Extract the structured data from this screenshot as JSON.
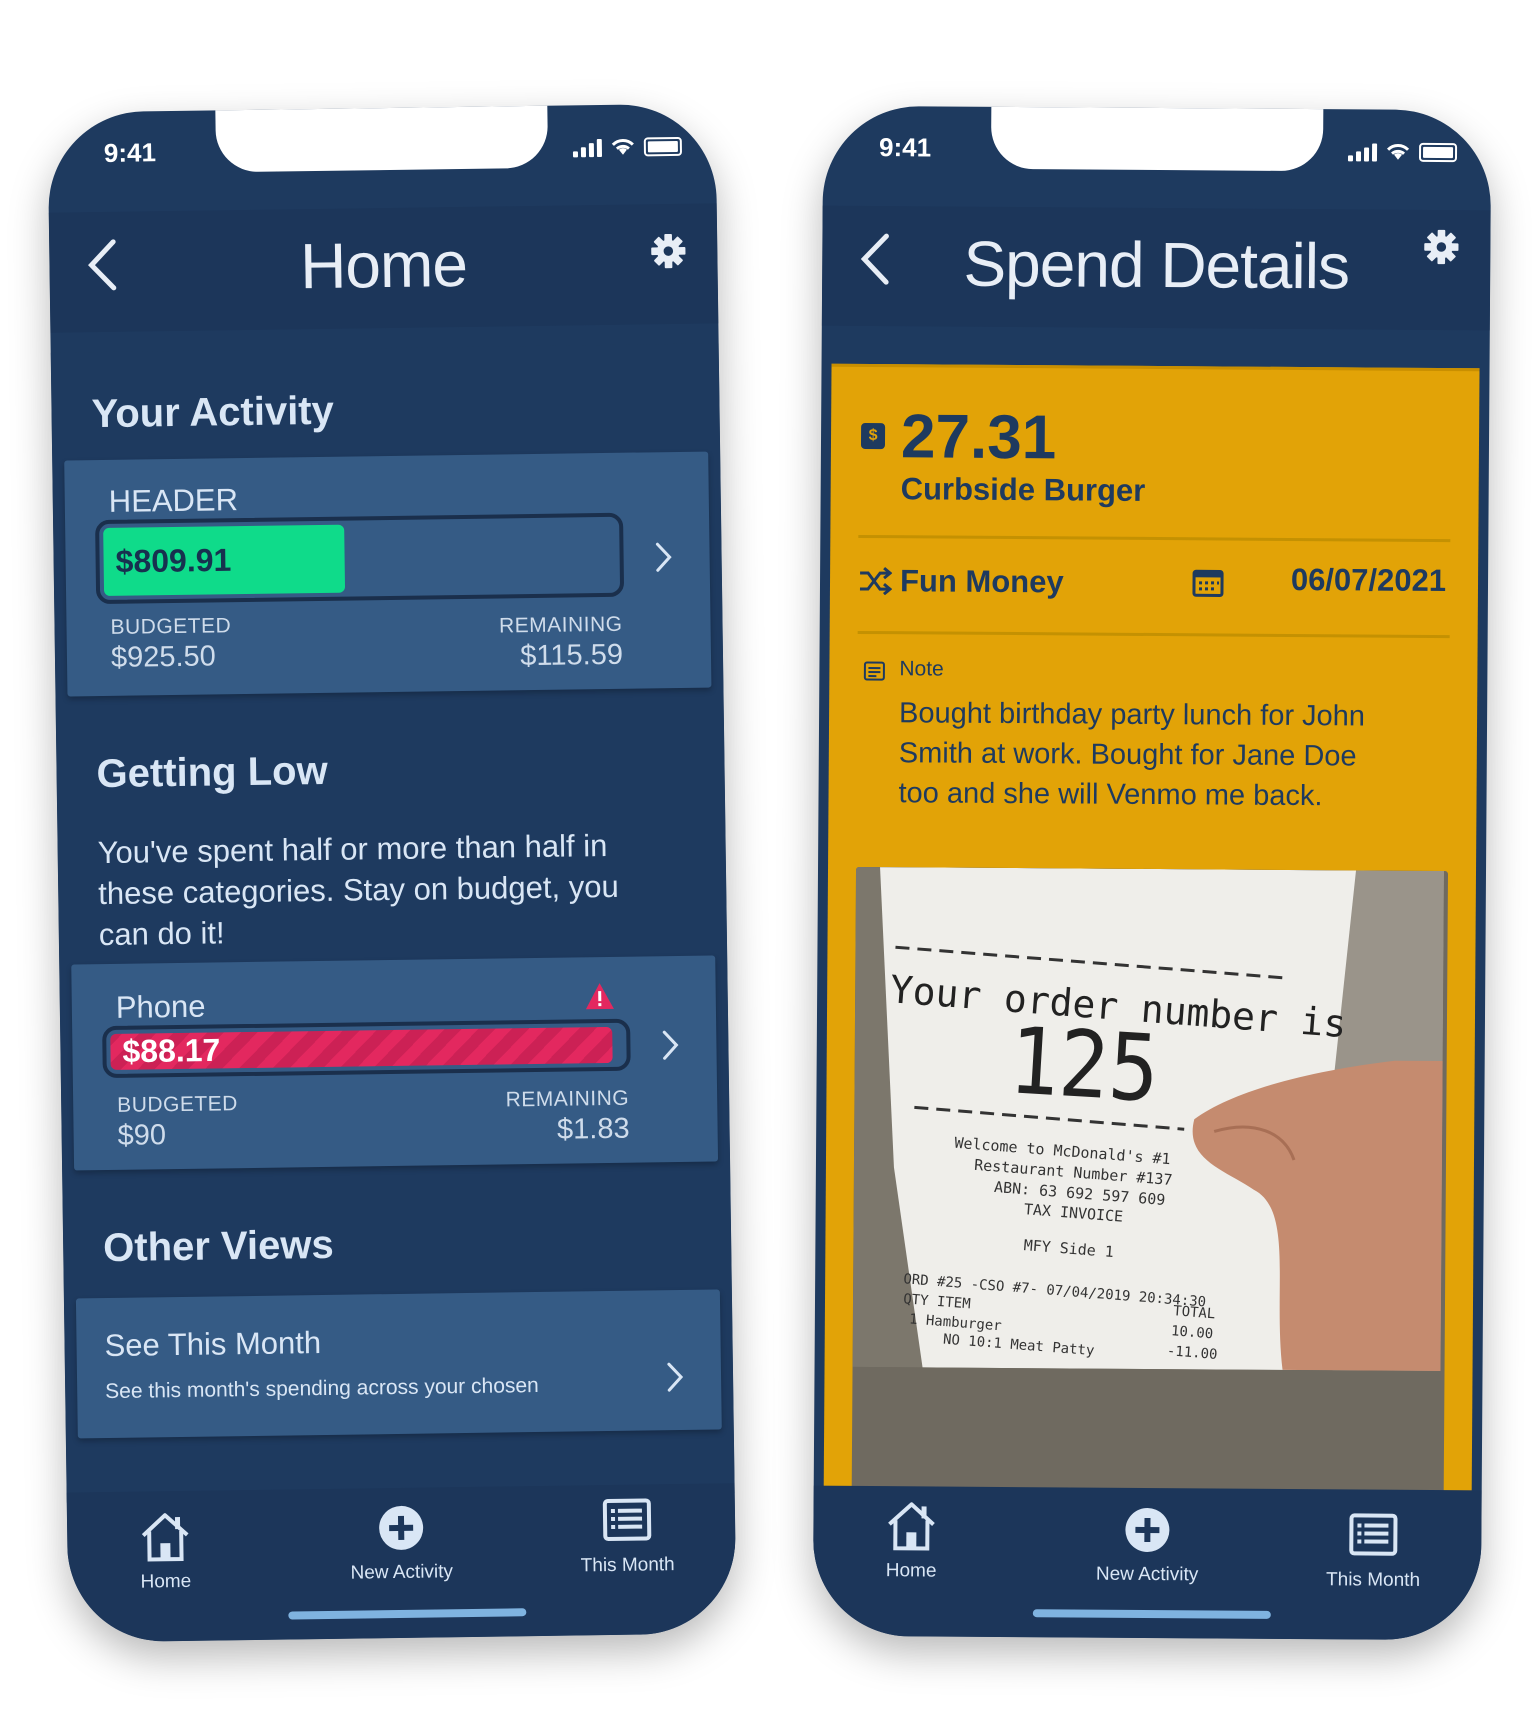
{
  "home_screen": {
    "status_time": "9:41",
    "title": "Home",
    "activity": {
      "title": "Your Activity",
      "card": {
        "label": "HEADER",
        "spent": "$809.91",
        "spent_fraction": 0.47,
        "budgeted_label": "BUDGETED",
        "budgeted_value": "$925.50",
        "remaining_label": "REMAINING",
        "remaining_value": "$115.59"
      }
    },
    "getting_low": {
      "title": "Getting Low",
      "description": "You've spent half or more than half in these categories. Stay on budget, you can do it!",
      "card": {
        "label": "Phone",
        "spent": "$88.17",
        "spent_fraction": 0.98,
        "budgeted_label": "BUDGETED",
        "budgeted_value": "$90",
        "remaining_label": "REMAINING",
        "remaining_value": "$1.83",
        "warning_icon": "warning-icon"
      }
    },
    "other_views": {
      "title": "Other Views",
      "card": {
        "title": "See This Month",
        "subtitle": "See this month's spending across your chosen"
      }
    }
  },
  "detail_screen": {
    "status_time": "9:41",
    "title": "Spend Details",
    "amount": "27.31",
    "merchant": "Curbside Burger",
    "category": "Fun Money",
    "date": "06/07/2021",
    "note_label": "Note",
    "note": "Bought birthday party lunch for John Smith at work. Bought for Jane Doe too and she will Venmo me back.",
    "receipt": {
      "line1": "Your order number is",
      "order_number": "125",
      "line2": "Welcome to McDonald's #1",
      "line3": "Restaurant Number #137",
      "line4": "ABN: 63 692 597 609",
      "line5": "TAX INVOICE",
      "line6": "MFY Side 1",
      "line7": "ORD #25 -CSO #7- 07/04/2019 20:34:30",
      "line8": "QTY ITEM",
      "line9": "1 Hamburger",
      "line10": "NO 10:1 Meat Patty",
      "col_total": "TOTAL",
      "val1": "10.00",
      "val2": "-11.00"
    }
  },
  "tabbar": {
    "home": "Home",
    "new_activity": "New Activity",
    "this_month": "This Month"
  },
  "colors": {
    "background": "#1e3a5f",
    "card": "#355b85",
    "progress_ok": "#0fdb8a",
    "progress_warning": "#e3285f",
    "detail_card": "#e2a307"
  }
}
